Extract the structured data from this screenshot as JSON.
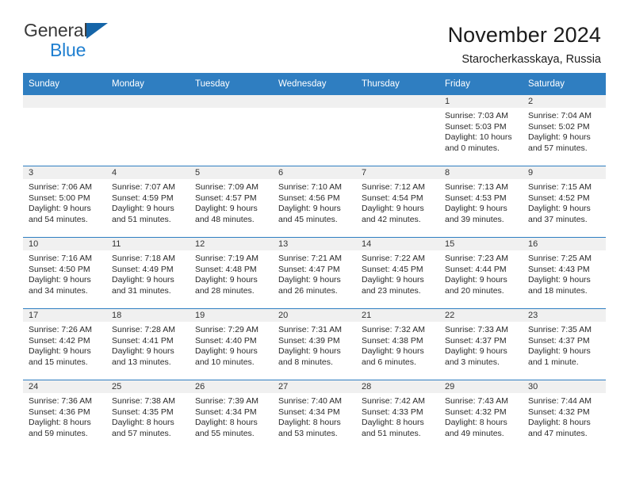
{
  "brand": {
    "name_part1": "General",
    "name_part2": "Blue"
  },
  "header": {
    "title": "November 2024",
    "subtitle": "Starocherkasskaya, Russia"
  },
  "colors": {
    "header_blue": "#2f7ec1",
    "logo_blue": "#1f7fd0",
    "daynum_band": "#f0f0f0"
  },
  "weekday_headers": [
    "Sunday",
    "Monday",
    "Tuesday",
    "Wednesday",
    "Thursday",
    "Friday",
    "Saturday"
  ],
  "labels": {
    "sunrise_prefix": "Sunrise: ",
    "sunset_prefix": "Sunset: ",
    "daylight_prefix": "Daylight: "
  },
  "weeks": [
    [
      {
        "day": "",
        "sunrise": "",
        "sunset": "",
        "daylight_line1": "",
        "daylight_line2": "",
        "empty": true
      },
      {
        "day": "",
        "sunrise": "",
        "sunset": "",
        "daylight_line1": "",
        "daylight_line2": "",
        "empty": true
      },
      {
        "day": "",
        "sunrise": "",
        "sunset": "",
        "daylight_line1": "",
        "daylight_line2": "",
        "empty": true
      },
      {
        "day": "",
        "sunrise": "",
        "sunset": "",
        "daylight_line1": "",
        "daylight_line2": "",
        "empty": true
      },
      {
        "day": "",
        "sunrise": "",
        "sunset": "",
        "daylight_line1": "",
        "daylight_line2": "",
        "empty": true
      },
      {
        "day": "1",
        "sunrise": "Sunrise: 7:03 AM",
        "sunset": "Sunset: 5:03 PM",
        "daylight_line1": "Daylight: 10 hours",
        "daylight_line2": "and 0 minutes.",
        "empty": false
      },
      {
        "day": "2",
        "sunrise": "Sunrise: 7:04 AM",
        "sunset": "Sunset: 5:02 PM",
        "daylight_line1": "Daylight: 9 hours",
        "daylight_line2": "and 57 minutes.",
        "empty": false
      }
    ],
    [
      {
        "day": "3",
        "sunrise": "Sunrise: 7:06 AM",
        "sunset": "Sunset: 5:00 PM",
        "daylight_line1": "Daylight: 9 hours",
        "daylight_line2": "and 54 minutes.",
        "empty": false
      },
      {
        "day": "4",
        "sunrise": "Sunrise: 7:07 AM",
        "sunset": "Sunset: 4:59 PM",
        "daylight_line1": "Daylight: 9 hours",
        "daylight_line2": "and 51 minutes.",
        "empty": false
      },
      {
        "day": "5",
        "sunrise": "Sunrise: 7:09 AM",
        "sunset": "Sunset: 4:57 PM",
        "daylight_line1": "Daylight: 9 hours",
        "daylight_line2": "and 48 minutes.",
        "empty": false
      },
      {
        "day": "6",
        "sunrise": "Sunrise: 7:10 AM",
        "sunset": "Sunset: 4:56 PM",
        "daylight_line1": "Daylight: 9 hours",
        "daylight_line2": "and 45 minutes.",
        "empty": false
      },
      {
        "day": "7",
        "sunrise": "Sunrise: 7:12 AM",
        "sunset": "Sunset: 4:54 PM",
        "daylight_line1": "Daylight: 9 hours",
        "daylight_line2": "and 42 minutes.",
        "empty": false
      },
      {
        "day": "8",
        "sunrise": "Sunrise: 7:13 AM",
        "sunset": "Sunset: 4:53 PM",
        "daylight_line1": "Daylight: 9 hours",
        "daylight_line2": "and 39 minutes.",
        "empty": false
      },
      {
        "day": "9",
        "sunrise": "Sunrise: 7:15 AM",
        "sunset": "Sunset: 4:52 PM",
        "daylight_line1": "Daylight: 9 hours",
        "daylight_line2": "and 37 minutes.",
        "empty": false
      }
    ],
    [
      {
        "day": "10",
        "sunrise": "Sunrise: 7:16 AM",
        "sunset": "Sunset: 4:50 PM",
        "daylight_line1": "Daylight: 9 hours",
        "daylight_line2": "and 34 minutes.",
        "empty": false
      },
      {
        "day": "11",
        "sunrise": "Sunrise: 7:18 AM",
        "sunset": "Sunset: 4:49 PM",
        "daylight_line1": "Daylight: 9 hours",
        "daylight_line2": "and 31 minutes.",
        "empty": false
      },
      {
        "day": "12",
        "sunrise": "Sunrise: 7:19 AM",
        "sunset": "Sunset: 4:48 PM",
        "daylight_line1": "Daylight: 9 hours",
        "daylight_line2": "and 28 minutes.",
        "empty": false
      },
      {
        "day": "13",
        "sunrise": "Sunrise: 7:21 AM",
        "sunset": "Sunset: 4:47 PM",
        "daylight_line1": "Daylight: 9 hours",
        "daylight_line2": "and 26 minutes.",
        "empty": false
      },
      {
        "day": "14",
        "sunrise": "Sunrise: 7:22 AM",
        "sunset": "Sunset: 4:45 PM",
        "daylight_line1": "Daylight: 9 hours",
        "daylight_line2": "and 23 minutes.",
        "empty": false
      },
      {
        "day": "15",
        "sunrise": "Sunrise: 7:23 AM",
        "sunset": "Sunset: 4:44 PM",
        "daylight_line1": "Daylight: 9 hours",
        "daylight_line2": "and 20 minutes.",
        "empty": false
      },
      {
        "day": "16",
        "sunrise": "Sunrise: 7:25 AM",
        "sunset": "Sunset: 4:43 PM",
        "daylight_line1": "Daylight: 9 hours",
        "daylight_line2": "and 18 minutes.",
        "empty": false
      }
    ],
    [
      {
        "day": "17",
        "sunrise": "Sunrise: 7:26 AM",
        "sunset": "Sunset: 4:42 PM",
        "daylight_line1": "Daylight: 9 hours",
        "daylight_line2": "and 15 minutes.",
        "empty": false
      },
      {
        "day": "18",
        "sunrise": "Sunrise: 7:28 AM",
        "sunset": "Sunset: 4:41 PM",
        "daylight_line1": "Daylight: 9 hours",
        "daylight_line2": "and 13 minutes.",
        "empty": false
      },
      {
        "day": "19",
        "sunrise": "Sunrise: 7:29 AM",
        "sunset": "Sunset: 4:40 PM",
        "daylight_line1": "Daylight: 9 hours",
        "daylight_line2": "and 10 minutes.",
        "empty": false
      },
      {
        "day": "20",
        "sunrise": "Sunrise: 7:31 AM",
        "sunset": "Sunset: 4:39 PM",
        "daylight_line1": "Daylight: 9 hours",
        "daylight_line2": "and 8 minutes.",
        "empty": false
      },
      {
        "day": "21",
        "sunrise": "Sunrise: 7:32 AM",
        "sunset": "Sunset: 4:38 PM",
        "daylight_line1": "Daylight: 9 hours",
        "daylight_line2": "and 6 minutes.",
        "empty": false
      },
      {
        "day": "22",
        "sunrise": "Sunrise: 7:33 AM",
        "sunset": "Sunset: 4:37 PM",
        "daylight_line1": "Daylight: 9 hours",
        "daylight_line2": "and 3 minutes.",
        "empty": false
      },
      {
        "day": "23",
        "sunrise": "Sunrise: 7:35 AM",
        "sunset": "Sunset: 4:37 PM",
        "daylight_line1": "Daylight: 9 hours",
        "daylight_line2": "and 1 minute.",
        "empty": false
      }
    ],
    [
      {
        "day": "24",
        "sunrise": "Sunrise: 7:36 AM",
        "sunset": "Sunset: 4:36 PM",
        "daylight_line1": "Daylight: 8 hours",
        "daylight_line2": "and 59 minutes.",
        "empty": false
      },
      {
        "day": "25",
        "sunrise": "Sunrise: 7:38 AM",
        "sunset": "Sunset: 4:35 PM",
        "daylight_line1": "Daylight: 8 hours",
        "daylight_line2": "and 57 minutes.",
        "empty": false
      },
      {
        "day": "26",
        "sunrise": "Sunrise: 7:39 AM",
        "sunset": "Sunset: 4:34 PM",
        "daylight_line1": "Daylight: 8 hours",
        "daylight_line2": "and 55 minutes.",
        "empty": false
      },
      {
        "day": "27",
        "sunrise": "Sunrise: 7:40 AM",
        "sunset": "Sunset: 4:34 PM",
        "daylight_line1": "Daylight: 8 hours",
        "daylight_line2": "and 53 minutes.",
        "empty": false
      },
      {
        "day": "28",
        "sunrise": "Sunrise: 7:42 AM",
        "sunset": "Sunset: 4:33 PM",
        "daylight_line1": "Daylight: 8 hours",
        "daylight_line2": "and 51 minutes.",
        "empty": false
      },
      {
        "day": "29",
        "sunrise": "Sunrise: 7:43 AM",
        "sunset": "Sunset: 4:32 PM",
        "daylight_line1": "Daylight: 8 hours",
        "daylight_line2": "and 49 minutes.",
        "empty": false
      },
      {
        "day": "30",
        "sunrise": "Sunrise: 7:44 AM",
        "sunset": "Sunset: 4:32 PM",
        "daylight_line1": "Daylight: 8 hours",
        "daylight_line2": "and 47 minutes.",
        "empty": false
      }
    ]
  ]
}
